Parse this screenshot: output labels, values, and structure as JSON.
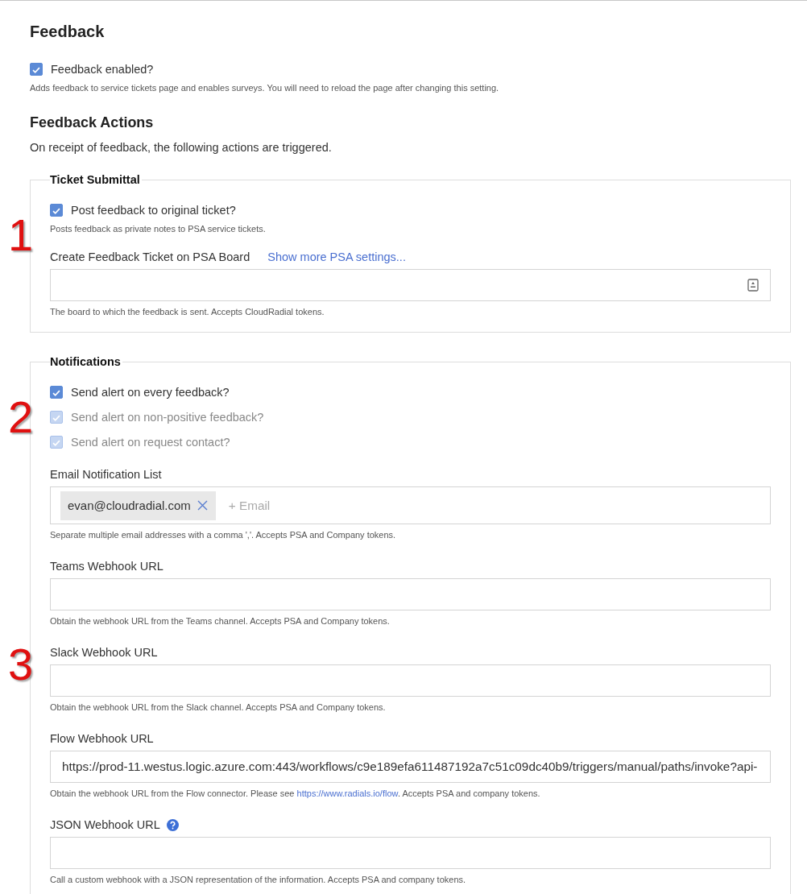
{
  "title": "Feedback",
  "feedback_enabled": {
    "label": "Feedback enabled?",
    "checked": true,
    "disabled": false,
    "hint": "Adds feedback to service tickets page and enables surveys. You will need to reload the page after changing this setting."
  },
  "actions": {
    "title": "Feedback Actions",
    "description": "On receipt of feedback, the following actions are triggered."
  },
  "sections": [
    {
      "title": "Ticket Submittal",
      "items": [
        {
          "kind": "checkbox",
          "label": "Post feedback to original ticket?",
          "checked": true,
          "disabled": false,
          "hint": "Posts feedback as private notes to PSA service tickets.",
          "annotation": "1"
        },
        {
          "kind": "board-field",
          "label": "Create Feedback Ticket on PSA Board",
          "link": "Show more PSA settings...",
          "hint": [
            {
              "text": "The board to which the feedback is sent. Accepts CloudRadial tokens."
            }
          ]
        }
      ]
    },
    {
      "title": "Notifications",
      "items": [
        {
          "kind": "checkbox",
          "label": "Send alert on every feedback?",
          "checked": true,
          "disabled": false
        },
        {
          "kind": "checkbox",
          "label": "Send alert on non-positive feedback?",
          "checked": true,
          "disabled": true,
          "annotation": "2"
        },
        {
          "kind": "checkbox",
          "label": "Send alert on request contact?",
          "checked": true,
          "disabled": true
        },
        {
          "kind": "tag-field",
          "label": "Email Notification List",
          "tags": [
            "evan@cloudradial.com"
          ],
          "placeholder": "+ Email",
          "hint": [
            {
              "text": "Separate multiple email addresses with a comma ','. Accepts PSA and Company tokens."
            }
          ]
        },
        {
          "kind": "field",
          "label": "Teams Webhook URL",
          "hint": [
            {
              "text": "Obtain the webhook URL from the Teams channel. Accepts PSA and Company tokens."
            }
          ]
        },
        {
          "kind": "field",
          "label": "Slack Webhook URL",
          "annotation": "3",
          "hint": [
            {
              "text": "Obtain the webhook URL from the Slack channel. Accepts PSA and Company tokens."
            }
          ]
        },
        {
          "kind": "field",
          "label": "Flow Webhook URL",
          "value": "https://prod-11.westus.logic.azure.com:443/workflows/c9e189efa611487192a7c51c09dc40b9/triggers/manual/paths/invoke?api-",
          "hint": [
            {
              "text": "Obtain the webhook URL from the Flow connector. Please see "
            },
            {
              "text": "https://www.radials.io/flow",
              "kind": "link"
            },
            {
              "text": ". Accepts PSA and company tokens."
            }
          ]
        },
        {
          "kind": "help-field",
          "label": "JSON Webhook URL",
          "hint": [
            {
              "text": "Call a custom webhook with a JSON representation of the information. Accepts PSA and company tokens."
            }
          ]
        }
      ]
    }
  ]
}
